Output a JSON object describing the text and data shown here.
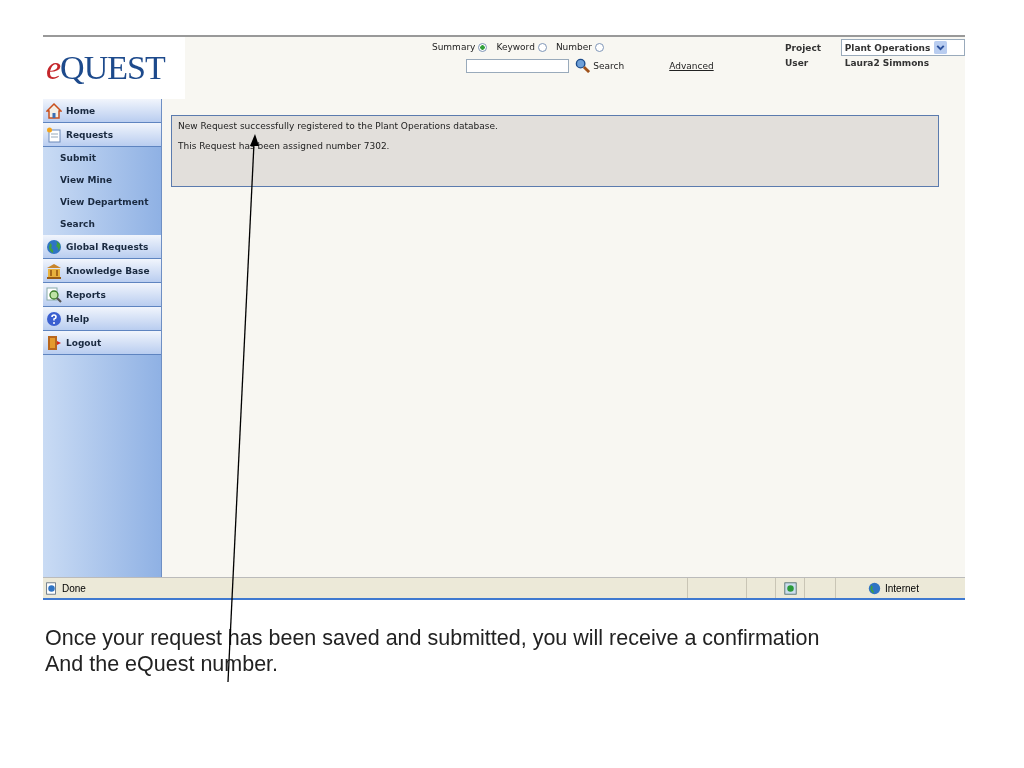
{
  "logo": {
    "prefix": "e",
    "name": "QUEST"
  },
  "search": {
    "options": [
      {
        "label": "Summary",
        "selected": true
      },
      {
        "label": "Keyword",
        "selected": false
      },
      {
        "label": "Number",
        "selected": false
      }
    ],
    "button": "Search",
    "advanced_link": "Advanced"
  },
  "account": {
    "project_label": "Project",
    "project": "Plant Operations",
    "user_label": "User",
    "user": "Laura2 Simmons"
  },
  "sidebar": {
    "items": [
      {
        "label": "Home"
      },
      {
        "label": "Requests",
        "children": [
          {
            "label": "Submit"
          },
          {
            "label": "View Mine"
          },
          {
            "label": "View Department"
          },
          {
            "label": "Search"
          }
        ]
      },
      {
        "label": "Global Requests"
      },
      {
        "label": "Knowledge Base"
      },
      {
        "label": "Reports"
      },
      {
        "label": "Help"
      },
      {
        "label": "Logout"
      }
    ]
  },
  "message": {
    "lines": [
      "New Request successfully registered to the Plant Operations database.",
      "This Request has been assigned number 7302."
    ]
  },
  "status_bar": {
    "status": "Done",
    "zone": "Internet"
  },
  "caption": {
    "lines": [
      "Once your request has been saved and submitted, you will receive a confirmation",
      "And the eQuest number."
    ]
  }
}
